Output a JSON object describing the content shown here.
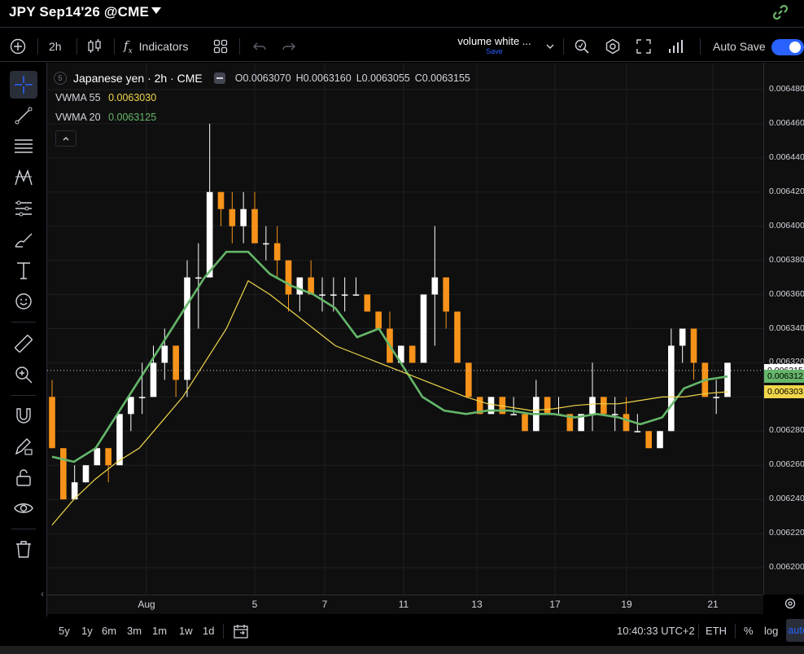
{
  "window": {
    "title": "JPY Sep14'26 @CME"
  },
  "toolbar": {
    "interval": "2h",
    "indicators_label": "Indicators",
    "layout_name": "volume white ...",
    "layout_status": "Save",
    "auto_save_label": "Auto Save",
    "auto_save_on": true
  },
  "legend": {
    "badge": "5",
    "symbol": "Japanese yen · 2h · CME",
    "open": "O0.0063070",
    "high": "H0.0063160",
    "low": "L0.0063055",
    "close": "C0.0063155"
  },
  "indicators": [
    {
      "name": "VWMA 55",
      "value": "0.0063030",
      "color": "#f0d64a"
    },
    {
      "name": "VWMA 20",
      "value": "0.0063125",
      "color": "#65b66a"
    }
  ],
  "price_axis": {
    "labels": [
      "0.006480",
      "0.006460",
      "0.006440",
      "0.006420",
      "0.006400",
      "0.006380",
      "0.006360",
      "0.006340",
      "0.006320",
      "0.006280",
      "0.006260",
      "0.006240",
      "0.006220",
      "0.006200"
    ],
    "tags": [
      {
        "text": "0.006315",
        "bg": "#ffffff",
        "fg": "#000000"
      },
      {
        "text": "0.006312",
        "bg": "#65b66a",
        "fg": "#000000"
      },
      {
        "text": "0.006303",
        "bg": "#f0d64a",
        "fg": "#000000"
      }
    ]
  },
  "time_axis": [
    "Aug",
    "5",
    "7",
    "11",
    "13",
    "17",
    "19",
    "21"
  ],
  "bottom": {
    "ranges": [
      "5y",
      "1y",
      "6m",
      "3m",
      "1m",
      "1w",
      "1d"
    ],
    "clock": "10:40:33 UTC+2",
    "session": "ETH",
    "percent": "%",
    "log": "log",
    "auto": "auto"
  },
  "chart_data": {
    "type": "candlestick",
    "title": "Japanese yen · 2h · CME",
    "x_labels": [
      "Aug",
      "5",
      "7",
      "11",
      "13",
      "17",
      "19",
      "21"
    ],
    "ylim": [
      0.00619,
      0.00649
    ],
    "up_color": "#ffffff",
    "down_color": "#f7931a",
    "candles": [
      [
        0.0063,
        0.00631,
        0.00627,
        0.00627
      ],
      [
        0.00627,
        0.00627,
        0.00624,
        0.00624
      ],
      [
        0.00624,
        0.00626,
        0.00624,
        0.00625
      ],
      [
        0.00625,
        0.00626,
        0.00625,
        0.00626
      ],
      [
        0.00626,
        0.00627,
        0.00626,
        0.00627
      ],
      [
        0.00627,
        0.00627,
        0.00625,
        0.00626
      ],
      [
        0.00626,
        0.00629,
        0.00626,
        0.00629
      ],
      [
        0.00629,
        0.0063,
        0.00628,
        0.0063
      ],
      [
        0.0063,
        0.00632,
        0.00629,
        0.0063
      ],
      [
        0.0063,
        0.00633,
        0.0063,
        0.00632
      ],
      [
        0.00632,
        0.00634,
        0.00631,
        0.00633
      ],
      [
        0.00633,
        0.00633,
        0.0063,
        0.00631
      ],
      [
        0.00631,
        0.00638,
        0.0063,
        0.00637
      ],
      [
        0.00637,
        0.00639,
        0.00634,
        0.00637
      ],
      [
        0.00637,
        0.00646,
        0.00637,
        0.00642
      ],
      [
        0.00642,
        0.00642,
        0.0064,
        0.00641
      ],
      [
        0.00641,
        0.00642,
        0.00639,
        0.0064
      ],
      [
        0.0064,
        0.00642,
        0.00639,
        0.00641
      ],
      [
        0.00641,
        0.00642,
        0.00639,
        0.00639
      ],
      [
        0.00639,
        0.0064,
        0.00638,
        0.00639
      ],
      [
        0.00639,
        0.0064,
        0.00637,
        0.00638
      ],
      [
        0.00638,
        0.00638,
        0.00635,
        0.00636
      ],
      [
        0.00636,
        0.00637,
        0.00635,
        0.00637
      ],
      [
        0.00637,
        0.00638,
        0.00636,
        0.00636
      ],
      [
        0.00636,
        0.00637,
        0.00635,
        0.00636
      ],
      [
        0.00636,
        0.00637,
        0.00635,
        0.00636
      ],
      [
        0.00636,
        0.00637,
        0.00635,
        0.00636
      ],
      [
        0.00636,
        0.00637,
        0.00636,
        0.00636
      ],
      [
        0.00636,
        0.00636,
        0.00635,
        0.00635
      ],
      [
        0.00635,
        0.00635,
        0.00634,
        0.00634
      ],
      [
        0.00634,
        0.00635,
        0.00632,
        0.00632
      ],
      [
        0.00632,
        0.00633,
        0.00632,
        0.00633
      ],
      [
        0.00633,
        0.00633,
        0.00632,
        0.00632
      ],
      [
        0.00632,
        0.00636,
        0.00632,
        0.00636
      ],
      [
        0.00636,
        0.0064,
        0.00633,
        0.00637
      ],
      [
        0.00637,
        0.00637,
        0.00634,
        0.00635
      ],
      [
        0.00635,
        0.00635,
        0.00632,
        0.00632
      ],
      [
        0.00632,
        0.00632,
        0.0063,
        0.0063
      ],
      [
        0.0063,
        0.0063,
        0.00629,
        0.00629
      ],
      [
        0.00629,
        0.0063,
        0.00629,
        0.0063
      ],
      [
        0.0063,
        0.0063,
        0.00629,
        0.00629
      ],
      [
        0.00629,
        0.0063,
        0.00629,
        0.00629
      ],
      [
        0.00629,
        0.00629,
        0.00628,
        0.00628
      ],
      [
        0.00628,
        0.00631,
        0.00628,
        0.0063
      ],
      [
        0.0063,
        0.0063,
        0.00629,
        0.00629
      ],
      [
        0.00629,
        0.0063,
        0.00629,
        0.00629
      ],
      [
        0.00629,
        0.00629,
        0.00628,
        0.00628
      ],
      [
        0.00628,
        0.00629,
        0.00628,
        0.00629
      ],
      [
        0.00629,
        0.00632,
        0.00628,
        0.0063
      ],
      [
        0.0063,
        0.0063,
        0.00629,
        0.00629
      ],
      [
        0.00629,
        0.0063,
        0.00628,
        0.00629
      ],
      [
        0.00629,
        0.0063,
        0.00628,
        0.00628
      ],
      [
        0.00628,
        0.00629,
        0.00628,
        0.00628
      ],
      [
        0.00628,
        0.00628,
        0.00627,
        0.00627
      ],
      [
        0.00627,
        0.00628,
        0.00627,
        0.00628
      ],
      [
        0.00628,
        0.00634,
        0.00628,
        0.00633
      ],
      [
        0.00633,
        0.00634,
        0.00632,
        0.00634
      ],
      [
        0.00634,
        0.00634,
        0.00631,
        0.00632
      ],
      [
        0.00632,
        0.00632,
        0.0063,
        0.0063
      ],
      [
        0.0063,
        0.00631,
        0.00629,
        0.0063
      ],
      [
        0.0063,
        0.00632,
        0.0063,
        0.00632
      ]
    ],
    "series": [
      {
        "name": "VWMA 20",
        "color": "#65b66a",
        "values": [
          0.006265,
          0.006262,
          0.00627,
          0.00629,
          0.00631,
          0.00633,
          0.00635,
          0.00637,
          0.006385,
          0.006385,
          0.006372,
          0.006365,
          0.00636,
          0.006352,
          0.006335,
          0.00634,
          0.00632,
          0.0063,
          0.006292,
          0.00629,
          0.006292,
          0.006292,
          0.00629,
          0.00629,
          0.006288,
          0.00629,
          0.006288,
          0.006284,
          0.006288,
          0.006305,
          0.00631,
          0.006312
        ]
      },
      {
        "name": "VWMA 55",
        "color": "#f0d64a",
        "values": [
          0.006225,
          0.00624,
          0.006252,
          0.006262,
          0.00627,
          0.006285,
          0.0063,
          0.00632,
          0.00634,
          0.006368,
          0.00636,
          0.00635,
          0.00634,
          0.00633,
          0.006325,
          0.00632,
          0.006315,
          0.00631,
          0.006305,
          0.0063,
          0.006296,
          0.006294,
          0.006292,
          0.006293,
          0.006295,
          0.006296,
          0.006296,
          0.006298,
          0.0063,
          0.0063,
          0.006302,
          0.006303
        ]
      }
    ],
    "last_price": 0.0063155
  }
}
